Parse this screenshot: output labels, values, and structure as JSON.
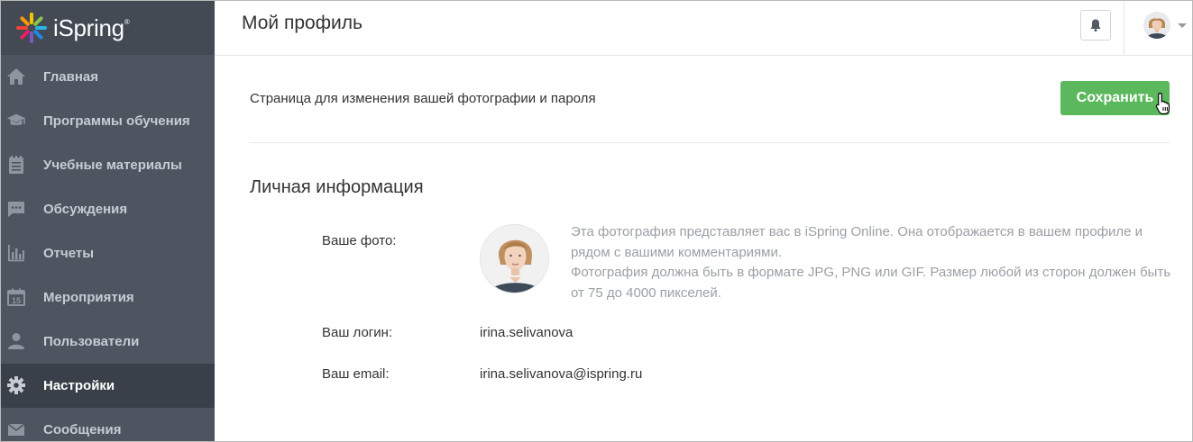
{
  "app": {
    "brand": "iSpring",
    "brand_mark": "®"
  },
  "sidebar": {
    "items": [
      {
        "label": "Главная",
        "icon": "home-icon"
      },
      {
        "label": "Программы обучения",
        "icon": "graduation-cap-icon"
      },
      {
        "label": "Учебные материалы",
        "icon": "notepad-icon"
      },
      {
        "label": "Обсуждения",
        "icon": "chat-icon"
      },
      {
        "label": "Отчеты",
        "icon": "bar-chart-icon"
      },
      {
        "label": "Мероприятия",
        "icon": "calendar-icon",
        "calendar_number": "15"
      },
      {
        "label": "Пользователи",
        "icon": "user-icon"
      },
      {
        "label": "Настройки",
        "icon": "gear-icon",
        "active": true
      },
      {
        "label": "Сообщения",
        "icon": "envelope-icon"
      }
    ]
  },
  "header": {
    "title": "Мой профиль"
  },
  "main": {
    "subtitle": "Страница для изменения вашей фотографии и пароля",
    "save_label": "Сохранить",
    "section_title": "Личная информация",
    "photo_label": "Ваше фото:",
    "photo_help_1": "Эта фотография представляет вас в iSpring Online. Она отображается в вашем профиле и рядом с вашими комментариями.",
    "photo_help_2": "Фотография должна быть в формате JPG, PNG или GIF. Размер любой из сторон должен быть от 75 до 4000 пикселей.",
    "login_label": "Ваш логин:",
    "login_value": "irina.selivanova",
    "email_label": "Ваш email:",
    "email_value": "irina.selivanova@ispring.ru"
  },
  "colors": {
    "sidebar_bg": "#4d5560",
    "sidebar_active_bg": "#3a4049",
    "accent_green": "#5cb85c",
    "help_text": "#9aa0a6"
  }
}
